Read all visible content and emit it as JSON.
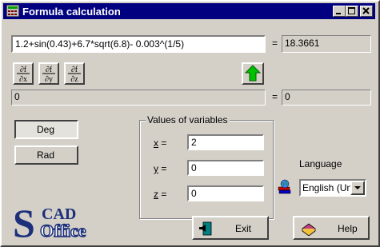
{
  "window": {
    "title": "Formula calculation"
  },
  "formula": {
    "expression": "1.2+sin(0.43)+6.7*sqrt(6.8)- 0.003^(1/5)",
    "equals": "=",
    "result": "18.3661"
  },
  "derivatives": [
    {
      "top": "∂f",
      "bottom": "∂x"
    },
    {
      "top": "∂f",
      "bottom": "∂y"
    },
    {
      "top": "∂f",
      "bottom": "∂z"
    }
  ],
  "derivative_result": {
    "expression": "0",
    "equals": "=",
    "value": "0"
  },
  "angle_mode": {
    "deg_label": "Deg",
    "rad_label": "Rad",
    "selected": "Deg"
  },
  "variables": {
    "group_title": "Values of variables",
    "x": {
      "name": "x",
      "eq": " =",
      "value": "2"
    },
    "y": {
      "name": "y",
      "eq": " =",
      "value": "0"
    },
    "z": {
      "name": "z",
      "eq": " =",
      "value": "0"
    }
  },
  "language": {
    "label": "Language",
    "selected": "English (Un"
  },
  "buttons": {
    "exit": "Exit",
    "help": "Help"
  },
  "logo": {
    "text_top": "CAD",
    "text_bottom": "Office",
    "letter": "S"
  },
  "colors": {
    "titlebar": "#000080",
    "face": "#d4d0c8",
    "arrow_green": "#00c000"
  }
}
